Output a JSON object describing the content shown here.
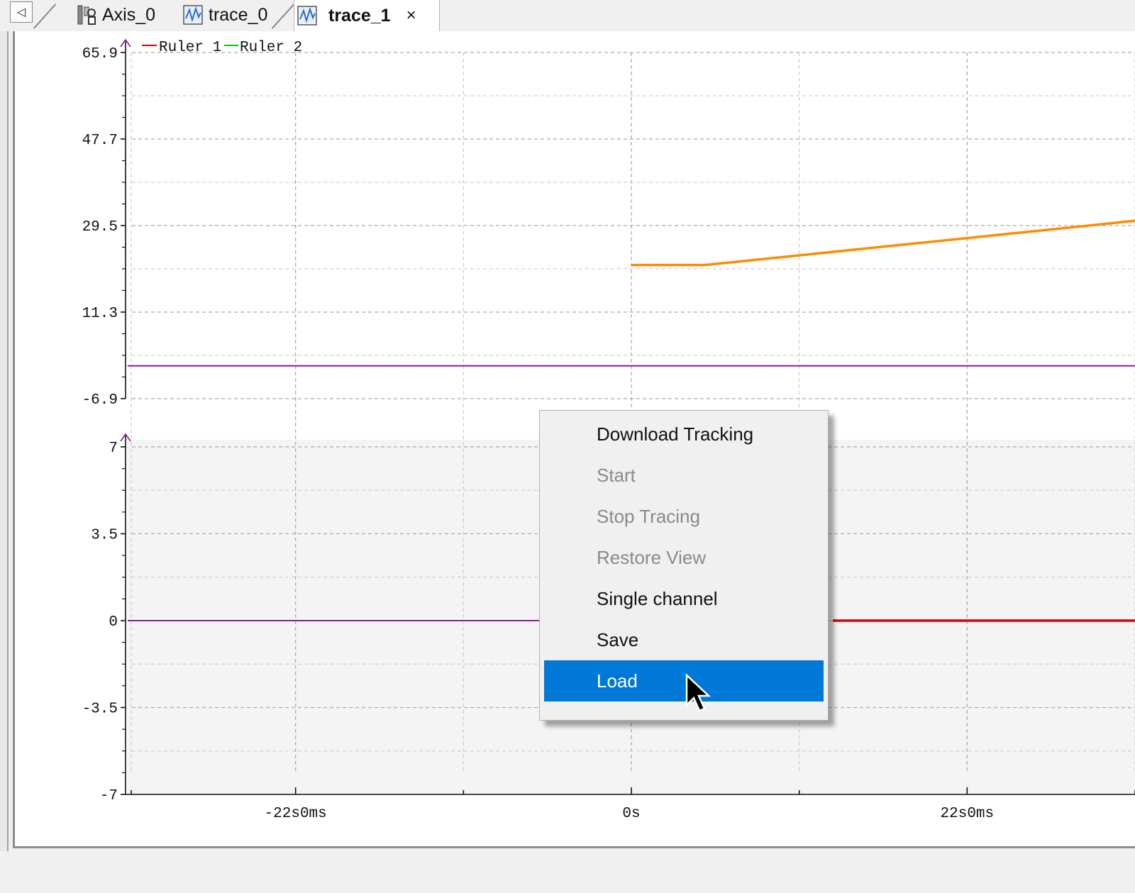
{
  "tabs": {
    "scroll_left": "◁",
    "items": [
      {
        "label": "Axis_0",
        "icon": "axis-icon"
      },
      {
        "label": "trace_0",
        "icon": "trace-icon"
      },
      {
        "label": "trace_1",
        "icon": "trace-icon",
        "active": true,
        "close": "×"
      }
    ]
  },
  "chart_data": [
    {
      "type": "line",
      "title": "",
      "legend": [
        "Ruler 1",
        "Ruler 2"
      ],
      "legend_colors": [
        "#e00000",
        "#00cc00"
      ],
      "legend_placement": "top-left",
      "grid": true,
      "ylim": [
        -6.9,
        65.9
      ],
      "yticks": [
        "65.9",
        "47.7",
        "29.5",
        "11.3",
        "-6.9"
      ],
      "series": [
        {
          "color": "#ff8c00",
          "x": [
            0,
            220,
            1500
          ],
          "y": [
            21.2,
            21.2,
            30.5
          ]
        },
        {
          "color": "#8b1a9b",
          "x": [
            -1500,
            1500
          ],
          "y": [
            0,
            0
          ]
        }
      ]
    },
    {
      "type": "line",
      "title": "",
      "grid": true,
      "ylim": [
        -7,
        7
      ],
      "yticks": [
        "7",
        "3.5",
        "0",
        "-3.5",
        "-7"
      ],
      "series": [
        {
          "color": "#8b1a9b",
          "x": [
            -1500,
            -240
          ],
          "y": [
            0,
            0
          ]
        },
        {
          "color": "#dd0000",
          "x": [
            600,
            1500
          ],
          "y": [
            0,
            0
          ]
        }
      ]
    }
  ],
  "x_axis": {
    "range_ms": [
      -1500,
      1500
    ],
    "ticks": [
      {
        "value": -1000,
        "label": "-22s0ms"
      },
      {
        "value": 0,
        "label": "0s"
      },
      {
        "value": 1000,
        "label": "22s0ms"
      }
    ]
  },
  "context_menu": {
    "items": [
      {
        "label": "Download Tracking",
        "enabled": true
      },
      {
        "label": "Start",
        "enabled": false
      },
      {
        "label": "Stop Tracing",
        "enabled": false
      },
      {
        "label": "Restore View",
        "enabled": false
      },
      {
        "label": "Single channel",
        "enabled": true
      },
      {
        "label": "Save",
        "enabled": true
      },
      {
        "label": "Load",
        "enabled": true,
        "selected": true
      }
    ]
  }
}
